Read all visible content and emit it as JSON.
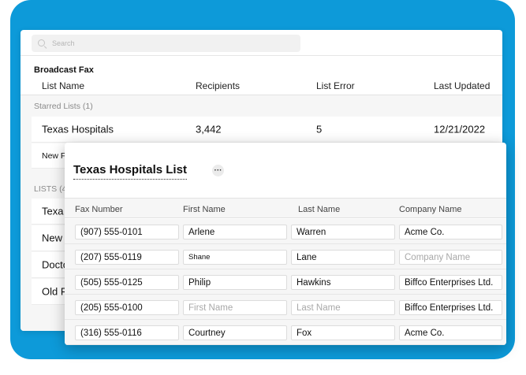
{
  "search": {
    "placeholder": "Search"
  },
  "broadcast": {
    "title": "Broadcast Fax",
    "columns": [
      "List Name",
      "Recipients",
      "List Error",
      "Last Updated"
    ],
    "starred_label": "Starred Lists (1)",
    "starred_rows": [
      {
        "name": "Texas Hospitals",
        "recipients": "3,442",
        "error": "5",
        "updated": "12/21/2022"
      },
      {
        "name": "New F",
        "recipients": "",
        "error": "",
        "updated": ""
      }
    ],
    "lists_label": "LISTS (4",
    "list_rows": [
      {
        "name": "Texa"
      },
      {
        "name": "New"
      },
      {
        "name": "Docto"
      },
      {
        "name": "Old F"
      }
    ]
  },
  "modal": {
    "title": "Texas Hospitals List",
    "more_label": "···",
    "columns": [
      "Fax Number",
      "First Name",
      "Last Name",
      "Company Name"
    ],
    "placeholders": {
      "first": "First Name",
      "last": "Last Name",
      "company": "Company Name"
    },
    "rows": [
      {
        "fax": "(907) 555-0101",
        "first": "Arlene",
        "last": "Warren",
        "company": "Acme Co."
      },
      {
        "fax": "(207) 555-0119",
        "first": "Shane",
        "last": "Lane",
        "company": ""
      },
      {
        "fax": "(505) 555-0125",
        "first": "Philip",
        "last": "Hawkins",
        "company": "Biffco Enterprises Ltd."
      },
      {
        "fax": "(205) 555-0100",
        "first": "",
        "last": "",
        "company": "Biffco Enterprises Ltd."
      },
      {
        "fax": "(316) 555-0116",
        "first": "Courtney",
        "last": "Fox",
        "company": "Acme Co."
      }
    ]
  },
  "colors": {
    "backdrop": "#0d9ad9",
    "panel": "#ffffff",
    "band": "#f6f6f6"
  },
  "icons": {
    "search": "search-icon",
    "more": "more-options-icon"
  }
}
